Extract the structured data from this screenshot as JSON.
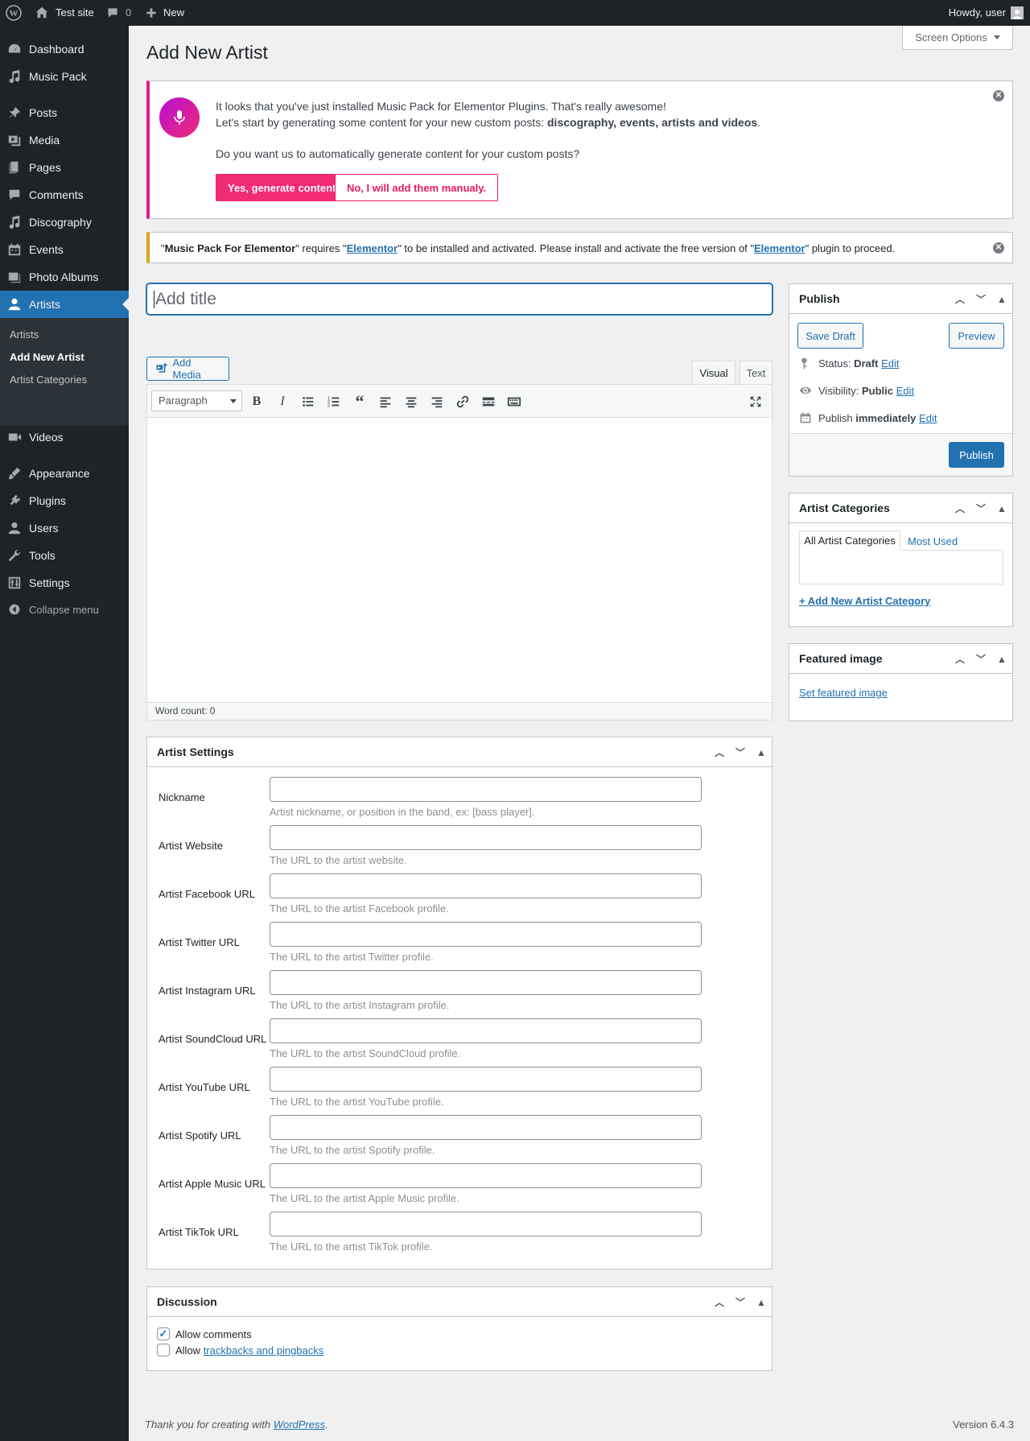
{
  "adminbar": {
    "site_name": "Test site",
    "comments_count": "0",
    "new_label": "New",
    "howdy": "Howdy, user"
  },
  "sidebar": {
    "items": [
      {
        "label": "Dashboard",
        "icon": "dashboard-icon"
      },
      {
        "label": "Music Pack",
        "icon": "music-icon"
      },
      {
        "label": "Posts",
        "icon": "pin-icon"
      },
      {
        "label": "Media",
        "icon": "media-icon"
      },
      {
        "label": "Pages",
        "icon": "pages-icon"
      },
      {
        "label": "Comments",
        "icon": "comments-icon"
      },
      {
        "label": "Discography",
        "icon": "music-icon"
      },
      {
        "label": "Events",
        "icon": "calendar-icon"
      },
      {
        "label": "Photo Albums",
        "icon": "photo-icon"
      },
      {
        "label": "Artists",
        "icon": "user-icon"
      },
      {
        "label": "Videos",
        "icon": "video-icon"
      },
      {
        "label": "Appearance",
        "icon": "brush-icon"
      },
      {
        "label": "Plugins",
        "icon": "plugin-icon"
      },
      {
        "label": "Users",
        "icon": "user-icon"
      },
      {
        "label": "Tools",
        "icon": "wrench-icon"
      },
      {
        "label": "Settings",
        "icon": "settings-icon"
      }
    ],
    "submenu": [
      "Artists",
      "Add New Artist",
      "Artist Categories"
    ],
    "collapse_label": "Collapse menu"
  },
  "page": {
    "title": "Add New Artist",
    "screen_options": "Screen Options"
  },
  "notice_musicpack": {
    "line1": "It looks that you've just installed Music Pack for Elementor Plugins. That's really awesome!",
    "line2_prefix": "Let's start by generating some content for your new custom posts: ",
    "line2_bold": "discography, events, artists and videos",
    "line2_suffix": ".",
    "question": "Do you want us to automatically generate content for your custom posts?",
    "yes_button": "Yes, generate content.",
    "no_button": "No, I will add them manualy."
  },
  "notice_elementor": {
    "q1": "\"",
    "plugin_name": "Music Pack For Elementor",
    "mid1": "\" requires \"",
    "link1": "Elementor",
    "mid2": "\" to be installed and activated. Please install and activate the free version of \"",
    "link2": "Elementor",
    "end": "\" plugin to proceed."
  },
  "editor": {
    "title_placeholder": "Add title",
    "add_media": "Add Media",
    "tab_visual": "Visual",
    "tab_text": "Text",
    "format_select": "Paragraph",
    "word_count": "Word count: 0"
  },
  "publish": {
    "title": "Publish",
    "save_draft": "Save Draft",
    "preview": "Preview",
    "status_label": "Status: ",
    "status_value": "Draft",
    "visibility_label": "Visibility: ",
    "visibility_value": "Public",
    "publish_label": "Publish ",
    "publish_value": "immediately",
    "edit": "Edit",
    "publish_button": "Publish"
  },
  "artist_categories": {
    "title": "Artist Categories",
    "tab_all": "All Artist Categories",
    "tab_used": "Most Used",
    "add_new": "+ Add New Artist Category"
  },
  "featured_image": {
    "title": "Featured image",
    "set_link": "Set featured image"
  },
  "artist_settings": {
    "title": "Artist Settings",
    "fields": [
      {
        "label": "Nickname",
        "desc": "Artist nickname, or position in the band, ex: [bass player]."
      },
      {
        "label": "Artist Website",
        "desc": "The URL to the artist website."
      },
      {
        "label": "Artist Facebook URL",
        "desc": "The URL to the artist Facebook profile."
      },
      {
        "label": "Artist Twitter URL",
        "desc": "The URL to the artist Twitter profile."
      },
      {
        "label": "Artist Instagram URL",
        "desc": "The URL to the artist Instagram profile."
      },
      {
        "label": "Artist SoundCloud URL",
        "desc": "The URL to the artist SoundCloud profile."
      },
      {
        "label": "Artist YouTube URL",
        "desc": "The URL to the artist YouTube profile."
      },
      {
        "label": "Artist Spotify URL",
        "desc": "The URL to the artist Spotify profile."
      },
      {
        "label": "Artist Apple Music URL",
        "desc": "The URL to the artist Apple Music profile."
      },
      {
        "label": "Artist TikTok URL",
        "desc": "The URL to the artist TikTok profile."
      }
    ]
  },
  "discussion": {
    "title": "Discussion",
    "allow_comments": "Allow comments",
    "allow_prefix": "Allow ",
    "trackbacks_link": "trackbacks and pingbacks"
  },
  "footer": {
    "thanks_prefix": "Thank you for creating with ",
    "wordpress_link": "WordPress",
    "thanks_suffix": ".",
    "version": "Version 6.4.3"
  },
  "colors": {
    "accent": "#2271b1",
    "pink": "#f02a73",
    "sidebar_bg": "#1d2327"
  }
}
